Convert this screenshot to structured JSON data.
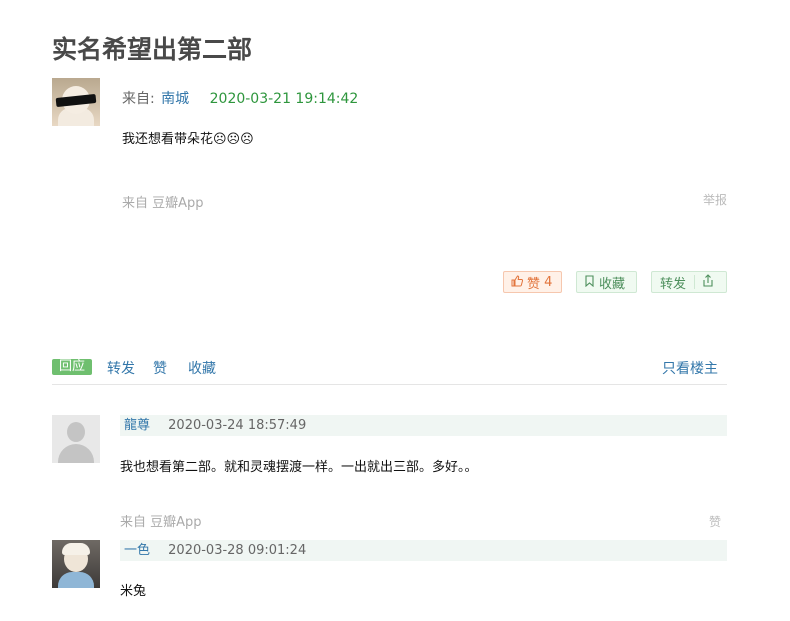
{
  "topic": {
    "title": "实名希望出第二部"
  },
  "post": {
    "from_prefix": "来自:",
    "author": "南城",
    "time": "2020-03-21 19:14:42",
    "content": "我还想看带朵花☹☹☹",
    "source": "来自 豆瓣App",
    "report": "举报"
  },
  "actions": {
    "like_label": "赞",
    "like_count": "4",
    "collect_label": "收藏",
    "share_label": "转发"
  },
  "tabs": {
    "reply": "回应",
    "share": "转发",
    "like": "赞",
    "collect": "收藏",
    "only_op": "只看楼主"
  },
  "comments": [
    {
      "author": "龍尊",
      "time": "2020-03-24 18:57:49",
      "content": "我也想看第二部。就和灵魂摆渡一样。一出就出三部。多好。。",
      "source": "来自 豆瓣App",
      "like": "赞"
    },
    {
      "author": "一色",
      "time": "2020-03-28 09:01:24",
      "content": "米兔"
    }
  ]
}
